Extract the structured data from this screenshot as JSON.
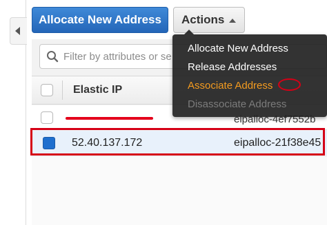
{
  "toolbar": {
    "allocate_label": "Allocate New Address",
    "actions_label": "Actions"
  },
  "filter": {
    "placeholder": "Filter by attributes or se"
  },
  "table": {
    "columns": [
      "Elastic IP"
    ],
    "rows": [
      {
        "elastic_ip": "",
        "allocation_id": "eipalloc-4ef7552b",
        "selected": false,
        "ip_redacted": true
      },
      {
        "elastic_ip": "52.40.137.172",
        "allocation_id": "eipalloc-21f38e45",
        "selected": true
      }
    ]
  },
  "actions_menu": {
    "items": [
      {
        "label": "Allocate New Address",
        "state": "enabled"
      },
      {
        "label": "Release Addresses",
        "state": "enabled"
      },
      {
        "label": "Associate Address",
        "state": "highlighted"
      },
      {
        "label": "Disassociate Address",
        "state": "disabled"
      }
    ]
  },
  "colors": {
    "primary_button": "#2a6fc4",
    "menu_highlight": "#f49b1f",
    "annotation_red": "#d50016",
    "selected_row": "#e8f1fb"
  },
  "icons": {
    "sidebar_toggle": "chevron-left-icon",
    "actions_caret": "caret-up-icon",
    "filter": "search-icon"
  }
}
